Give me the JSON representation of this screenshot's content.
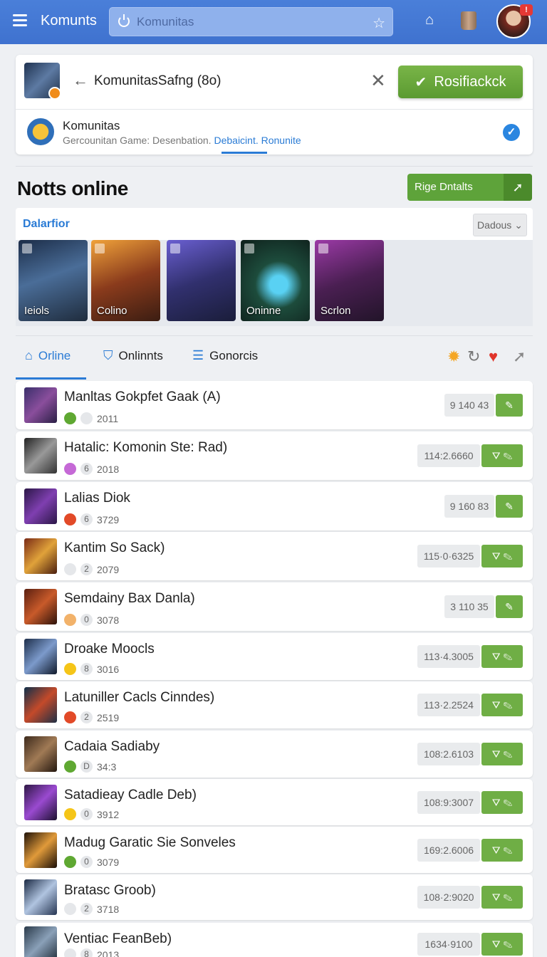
{
  "header": {
    "app_name": "Komunts",
    "search_placeholder": "Komunitas"
  },
  "community": {
    "title": "KomunitasSafng (8o)",
    "join_label": "Rosifiackck",
    "name": "Komunitas",
    "desc_prefix": "Gercounitan Game: Desenbation. ",
    "desc_link": "Debaicint. Ronunite"
  },
  "section": {
    "title": "Notts online",
    "range_label": "Rige Dntalts"
  },
  "gallery": {
    "heading": "Dalarfior",
    "dropdown": "Dadous",
    "cards": [
      {
        "label": "Ieiols"
      },
      {
        "label": "Colino"
      },
      {
        "label": ""
      },
      {
        "label": "Oninne"
      },
      {
        "label": "Scrlon"
      }
    ]
  },
  "tabs": [
    {
      "label": "Orline"
    },
    {
      "label": "Onlinnts"
    },
    {
      "label": "Gonorcis"
    }
  ],
  "rows": [
    {
      "title": "Manltas Gokpfet Gaak (A)",
      "n": "",
      "year": "2011",
      "score": "9 140 43",
      "double": false
    },
    {
      "title": "Hatalic: Komonin Ste: Rad)",
      "n": "6",
      "year": "2018",
      "score": "114:2.6660",
      "double": true
    },
    {
      "title": "Lalias Diok",
      "n": "6",
      "year": "3729",
      "score": "9 160 83",
      "double": false
    },
    {
      "title": "Kantim So Sack)",
      "n": "2",
      "year": "2079",
      "score": "115·0·6325",
      "double": true
    },
    {
      "title": "Semdainy Bax Danla)",
      "n": "0",
      "year": "3078",
      "score": "3 110 35",
      "double": false
    },
    {
      "title": "Droake Moocls",
      "n": "8",
      "year": "3016",
      "score": "113·4.3005",
      "double": true
    },
    {
      "title": "Latuniller Cacls Cinndes)",
      "n": "2",
      "year": "2519",
      "score": "113·2.2524",
      "double": true
    },
    {
      "title": "Cadaia Sadiaby",
      "n": "D",
      "year": "34:3",
      "score": "108:2.6103",
      "double": true
    },
    {
      "title": "Satadieay Cadle Deb)",
      "n": "0",
      "year": "3912",
      "score": "108:9:3007",
      "double": true
    },
    {
      "title": "Madug Garatic Sie Sonveles",
      "n": "0",
      "year": "3079",
      "score": "169:2.6006",
      "double": true
    },
    {
      "title": "Bratasc Groob)",
      "n": "2",
      "year": "3718",
      "score": "108·2:9020",
      "double": true
    },
    {
      "title": "Ventiac FeanBeb)",
      "n": "8",
      "year": "2013",
      "score": "1634·9100",
      "double": true
    }
  ]
}
